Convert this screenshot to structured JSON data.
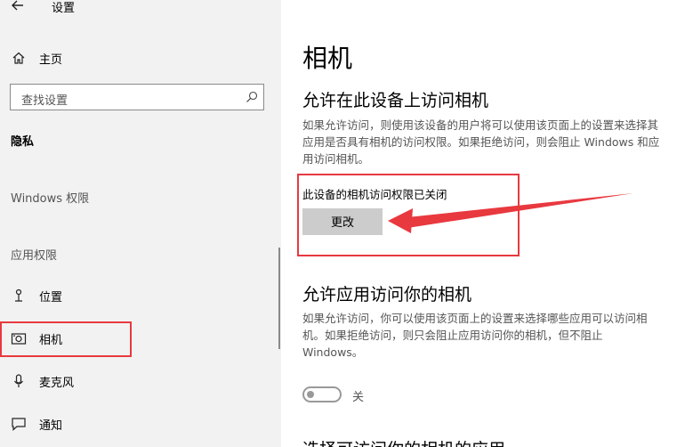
{
  "app": {
    "title": "设置"
  },
  "sidebar": {
    "home_label": "主页",
    "search_placeholder": "查找设置",
    "section_title": "隐私",
    "windows_perms_label": "Windows 权限",
    "app_perms_label": "应用权限",
    "items": [
      {
        "label": "位置",
        "icon": "location-icon"
      },
      {
        "label": "相机",
        "icon": "camera-icon",
        "selected": true
      },
      {
        "label": "麦克风",
        "icon": "microphone-icon"
      },
      {
        "label": "通知",
        "icon": "notification-icon"
      }
    ]
  },
  "main": {
    "page_title": "相机",
    "device_section": {
      "heading": "允许在此设备上访问相机",
      "description": "如果允许访问，则使用该设备的用户将可以使用该页面上的设置来选择其\n应用是否具有相机的访问权限。如果拒绝访问，则会阻止 Windows 和应\n用访问相机。",
      "status": "此设备的相机访问权限已关闭",
      "change_button": "更改"
    },
    "apps_section": {
      "heading": "允许应用访问你的相机",
      "description": "如果允许访问，你可以使用该页面上的设置来选择哪些应用可以访问相\n机。如果拒绝访问，则只会阻止应用访问你的相机，但不阻止\nWindows。",
      "toggle_state": "off",
      "toggle_label": "关"
    },
    "next_section_heading": "选择可访问你的相机的应用"
  },
  "annotation_color": "#e8393f"
}
